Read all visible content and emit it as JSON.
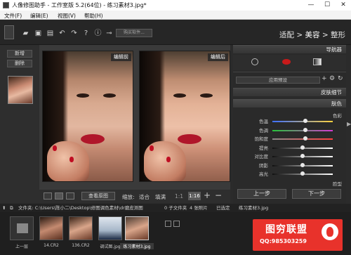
{
  "window": {
    "title": "人像修图助手 - 工作室版 5.2(64位) - 练习素材3.jpg*",
    "min": "—",
    "max": "☐",
    "close": "✕"
  },
  "menubar": [
    "文件(F)",
    "编辑(E)",
    "视图(V)",
    "帮助(H)"
  ],
  "toolbar": {
    "buy_label": "购买软件...",
    "modes": {
      "adapt": "适配",
      "sep1": ">",
      "beauty": "美容",
      "sep2": ">",
      "shape": "整形"
    }
  },
  "left_panel": {
    "new_label": "新增",
    "delete_label": "删除"
  },
  "viewer": {
    "before_label": "编辑前",
    "after_label": "编辑后",
    "view_original": "查看原图",
    "zoom_label": "缩放:",
    "fit_label": "适合",
    "fill_label": "填满",
    "ratio_label": "1:1",
    "zoom_value": "1:16",
    "plus": "+",
    "minus": "−"
  },
  "right_panel": {
    "navigator": "导航器",
    "preset": "应用预设",
    "skin_detail": "皮肤细节",
    "skin_color": "肤色",
    "color_section": "色彩",
    "sliders": [
      {
        "label": "色温",
        "value": 0.55,
        "color_from": "#3d6fff",
        "color_to": "#ffd23d"
      },
      {
        "label": "色调",
        "value": 0.55,
        "color_from": "#27c43a",
        "color_to": "#d43ad4"
      },
      {
        "label": "饱和度",
        "value": 0.55,
        "color_from": "#8a8a8a",
        "color_to": "#ff4040"
      },
      {
        "label": "提亮",
        "value": 0.5,
        "color_from": "#111111",
        "color_to": "#ffffff"
      },
      {
        "label": "对比度",
        "value": 0.5,
        "color_from": "#111111",
        "color_to": "#ffffff"
      },
      {
        "label": "阴影",
        "value": 0.5,
        "color_from": "#111111",
        "color_to": "#ffffff"
      },
      {
        "label": "高光",
        "value": 0.5,
        "color_from": "#111111",
        "color_to": "#ffffff"
      }
    ],
    "red_eye": "脸型",
    "prev_label": "上一步",
    "next_label": "下一步"
  },
  "pathbar": {
    "file_label": "文件夹: C:\\Users\\陈小二\\Desktop\\修图调色素材\\dr磨皮测图",
    "subfolders": "0 子文件夹",
    "photos": "4 张照片",
    "selected": "已选定",
    "current": "练习素材3.jpg"
  },
  "filmstrip": [
    {
      "label": "上一层"
    },
    {
      "label": "14.CR2"
    },
    {
      "label": "136.CR2"
    },
    {
      "label": "调试图.jpg"
    },
    {
      "label": "练习素材3.jpg"
    }
  ],
  "watermark": {
    "name": "图穷联盟",
    "qq": "QQ:985303259"
  }
}
